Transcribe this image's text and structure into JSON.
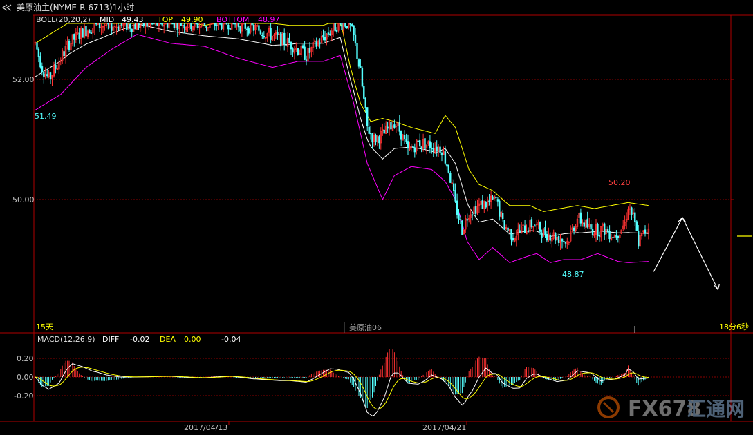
{
  "window": {
    "title": "美原油主(NYME-R 6713)1小时",
    "back_icon": "back-arrows-icon"
  },
  "colors": {
    "up": "#ff3232",
    "down": "#54ffff",
    "mid": "#ffffff",
    "top": "#ffff00",
    "bottom": "#ff00ff",
    "diff": "#ffffff",
    "dea": "#ffff00",
    "grid": "#8a0000",
    "axis": "#b00000",
    "label_red": "#ff4040",
    "label_cyan": "#54ffff"
  },
  "indicator": {
    "name": "BOLL(20,20,2)",
    "mid_label": "MID",
    "mid_value": "49.43",
    "top_label": "TOP",
    "top_value": "49.90",
    "bottom_label": "BOTTOM",
    "bottom_value": "48.97"
  },
  "price_axis": {
    "ticks": [
      "52.00",
      "50.00"
    ]
  },
  "annotations": {
    "left_low": "51.49",
    "high": "50.20",
    "low": "48.87"
  },
  "bottom_bar": {
    "period": "15天",
    "contract": "美原油06",
    "countdown": "18分6秒"
  },
  "macd": {
    "name": "MACD(12,26,9)",
    "diff_label": "DIFF",
    "diff_value": "-0.02",
    "dea_label": "DEA",
    "dea_value": "0.00",
    "macd_value": "-0.04",
    "ticks": [
      "0.20",
      "0.00",
      "-0.20"
    ]
  },
  "date_axis": {
    "labels": [
      "2017/04/13",
      "2017/04/21"
    ]
  },
  "watermark": {
    "text": "FX678",
    "suffix": "汇通网"
  },
  "chart_data": {
    "type": "candlestick",
    "instrument": "美原油主(NYME-R 6713)",
    "timeframe": "1小时",
    "y_ticks": [
      52.0,
      50.0
    ],
    "x_labels": [
      "2017/04/13",
      "2017/04/21"
    ],
    "annotations": [
      {
        "label": "51.49",
        "value": 51.49
      },
      {
        "label": "50.20",
        "value": 50.2
      },
      {
        "label": "48.87",
        "value": 48.87
      }
    ],
    "boll": {
      "mid": 49.43,
      "top": 49.9,
      "bottom": 48.97
    },
    "macd": {
      "diff": -0.02,
      "dea": 0.0,
      "macd": -0.04,
      "y_ticks": [
        0.2,
        0.0,
        -0.2
      ]
    },
    "path": [
      [
        0,
        52.6
      ],
      [
        4,
        52.2
      ],
      [
        8,
        52.0
      ],
      [
        14,
        52.3
      ],
      [
        20,
        52.6
      ],
      [
        28,
        52.8
      ],
      [
        36,
        52.9
      ],
      [
        46,
        52.9
      ],
      [
        60,
        52.9
      ],
      [
        80,
        52.95
      ],
      [
        100,
        52.9
      ],
      [
        115,
        52.95
      ],
      [
        130,
        52.85
      ],
      [
        150,
        52.6
      ],
      [
        160,
        52.4
      ],
      [
        170,
        52.7
      ],
      [
        178,
        52.9
      ],
      [
        185,
        52.95
      ],
      [
        188,
        52.7
      ],
      [
        192,
        52.1
      ],
      [
        196,
        51.2
      ],
      [
        200,
        51.0
      ],
      [
        206,
        51.1
      ],
      [
        212,
        51.3
      ],
      [
        216,
        51.1
      ],
      [
        220,
        50.8
      ],
      [
        226,
        50.95
      ],
      [
        234,
        50.9
      ],
      [
        240,
        50.85
      ],
      [
        244,
        50.5
      ],
      [
        248,
        49.9
      ],
      [
        252,
        49.5
      ],
      [
        256,
        49.8
      ],
      [
        262,
        49.9
      ],
      [
        268,
        49.95
      ],
      [
        272,
        50.0
      ],
      [
        276,
        49.6
      ],
      [
        282,
        49.4
      ],
      [
        288,
        49.5
      ],
      [
        294,
        49.6
      ],
      [
        300,
        49.45
      ],
      [
        306,
        49.4
      ],
      [
        314,
        49.3
      ],
      [
        320,
        49.7
      ],
      [
        328,
        49.5
      ],
      [
        336,
        49.5
      ],
      [
        342,
        49.4
      ],
      [
        348,
        49.6
      ],
      [
        350,
        49.9
      ],
      [
        353,
        49.7
      ],
      [
        356,
        49.3
      ],
      [
        362,
        49.55
      ]
    ],
    "band_top_path": [
      [
        0,
        52.6
      ],
      [
        20,
        52.95
      ],
      [
        40,
        53.0
      ],
      [
        60,
        53.1
      ],
      [
        80,
        53.0
      ],
      [
        100,
        52.9
      ],
      [
        120,
        53.0
      ],
      [
        150,
        52.9
      ],
      [
        170,
        52.9
      ],
      [
        180,
        53.0
      ],
      [
        186,
        52.2
      ],
      [
        192,
        51.6
      ],
      [
        198,
        51.3
      ],
      [
        205,
        51.35
      ],
      [
        212,
        51.3
      ],
      [
        222,
        51.2
      ],
      [
        236,
        51.1
      ],
      [
        242,
        51.4
      ],
      [
        248,
        51.2
      ],
      [
        256,
        50.5
      ],
      [
        262,
        50.25
      ],
      [
        270,
        50.15
      ],
      [
        280,
        49.9
      ],
      [
        292,
        49.9
      ],
      [
        300,
        49.8
      ],
      [
        310,
        49.85
      ],
      [
        320,
        49.9
      ],
      [
        330,
        49.85
      ],
      [
        340,
        49.9
      ],
      [
        350,
        49.95
      ],
      [
        362,
        49.9
      ]
    ],
    "band_bottom_path": [
      [
        0,
        51.49
      ],
      [
        15,
        51.75
      ],
      [
        30,
        52.2
      ],
      [
        45,
        52.5
      ],
      [
        60,
        52.75
      ],
      [
        80,
        52.6
      ],
      [
        100,
        52.55
      ],
      [
        120,
        52.35
      ],
      [
        140,
        52.2
      ],
      [
        155,
        52.3
      ],
      [
        170,
        52.3
      ],
      [
        180,
        52.4
      ],
      [
        188,
        51.6
      ],
      [
        196,
        50.6
      ],
      [
        205,
        50.0
      ],
      [
        212,
        50.4
      ],
      [
        222,
        50.55
      ],
      [
        234,
        50.5
      ],
      [
        242,
        50.3
      ],
      [
        248,
        50.0
      ],
      [
        255,
        49.3
      ],
      [
        262,
        49.0
      ],
      [
        270,
        49.2
      ],
      [
        280,
        48.95
      ],
      [
        290,
        49.05
      ],
      [
        296,
        49.1
      ],
      [
        304,
        48.95
      ],
      [
        312,
        49.0
      ],
      [
        322,
        49.0
      ],
      [
        332,
        49.1
      ],
      [
        344,
        48.97
      ],
      [
        350,
        48.95
      ],
      [
        362,
        48.97
      ]
    ],
    "forecast_arrow": [
      [
        365,
        48.8
      ],
      [
        382,
        49.7
      ],
      [
        403,
        48.5
      ]
    ]
  }
}
